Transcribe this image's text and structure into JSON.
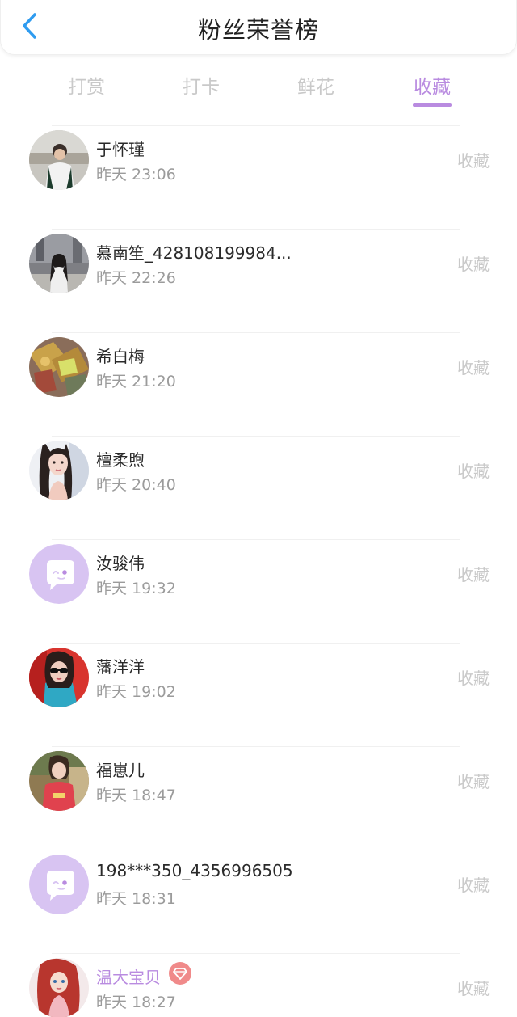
{
  "header": {
    "title": "粉丝荣誉榜",
    "back_icon": "chevron-left-icon",
    "accent_color": "#2f9cf0"
  },
  "tabs": [
    {
      "label": "打赏",
      "active": false
    },
    {
      "label": "打卡",
      "active": false
    },
    {
      "label": "鲜花",
      "active": false
    },
    {
      "label": "收藏",
      "active": true
    }
  ],
  "theme": {
    "active_color": "#b98be0",
    "inactive_color": "#c9c9c9",
    "badge_color": "#f08a8a"
  },
  "fans": [
    {
      "name": "于怀瑾",
      "time": "昨天 23:06",
      "action": "收藏",
      "avatar": "photo-avatar",
      "vip": false
    },
    {
      "name": "慕南笙_428108199984...",
      "time": "昨天 22:26",
      "action": "收藏",
      "avatar": "photo-avatar",
      "vip": false
    },
    {
      "name": "希白梅",
      "time": "昨天 21:20",
      "action": "收藏",
      "avatar": "photo-avatar",
      "vip": false
    },
    {
      "name": "檀柔煦",
      "time": "昨天 20:40",
      "action": "收藏",
      "avatar": "photo-avatar",
      "vip": false
    },
    {
      "name": "汝骏伟",
      "time": "昨天 19:32",
      "action": "收藏",
      "avatar": "default-chat-avatar",
      "vip": false
    },
    {
      "name": "藩洋洋",
      "time": "昨天 19:02",
      "action": "收藏",
      "avatar": "photo-avatar",
      "vip": false
    },
    {
      "name": "福崽儿",
      "time": "昨天 18:47",
      "action": "收藏",
      "avatar": "photo-avatar",
      "vip": false
    },
    {
      "name": "198***350_4356996505",
      "time": "昨天 18:31",
      "action": "收藏",
      "avatar": "default-chat-avatar",
      "vip": false
    },
    {
      "name": "温大宝贝",
      "time": "昨天 18:27",
      "action": "收藏",
      "avatar": "photo-avatar",
      "vip": true,
      "badge_icon": "diamond-icon"
    }
  ]
}
